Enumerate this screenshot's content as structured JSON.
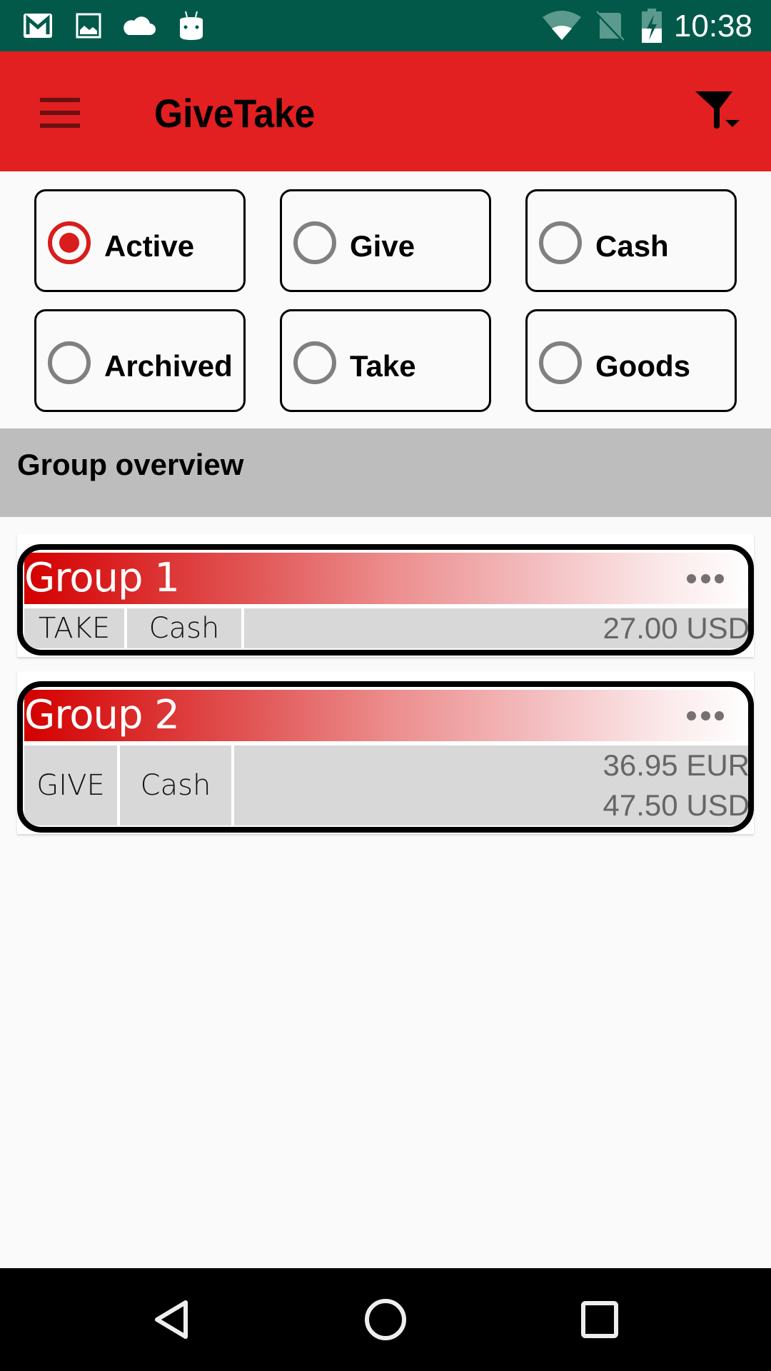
{
  "status_bar": {
    "time": "10:38",
    "left_icons": [
      "gmail-icon",
      "gallery-icon",
      "cloud-icon",
      "android-debug-icon"
    ],
    "right_icons": [
      "wifi-icon",
      "no-sim-icon",
      "battery-charging-icon"
    ],
    "background_color": "#02594a"
  },
  "app_bar": {
    "title": "GiveTake",
    "menu_icon": "hamburger-menu-icon",
    "filter_icon": "filter-dropdown-icon",
    "background_color": "#e21f21"
  },
  "filters": {
    "options": [
      {
        "label": "Active",
        "checked": true
      },
      {
        "label": "Give",
        "checked": false
      },
      {
        "label": "Cash",
        "checked": false
      },
      {
        "label": "Archived",
        "checked": false
      },
      {
        "label": "Take",
        "checked": false
      },
      {
        "label": "Goods",
        "checked": false
      }
    ],
    "accent_color": "#d91c1c"
  },
  "section": {
    "title": "Group overview"
  },
  "groups": [
    {
      "name": "Group 1",
      "direction": "TAKE",
      "type": "Cash",
      "amounts": [
        "27.00 USD"
      ]
    },
    {
      "name": "Group 2",
      "direction": "GIVE",
      "type": "Cash",
      "amounts": [
        "36.95 EUR",
        "47.50 USD"
      ]
    }
  ],
  "nav_bar": {
    "buttons": [
      "back-icon",
      "home-icon",
      "recents-icon"
    ]
  }
}
